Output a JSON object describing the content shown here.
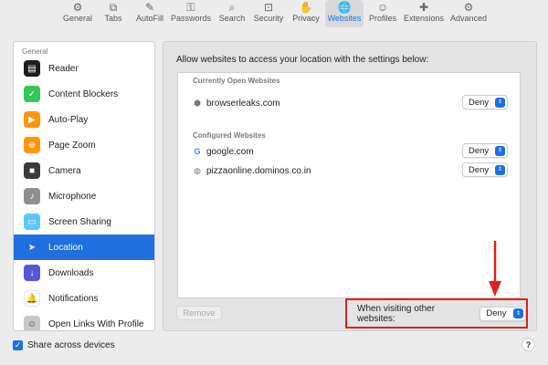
{
  "toolbar": {
    "items": [
      {
        "label": "General",
        "icon": "gear-icon",
        "glyph": "⚙"
      },
      {
        "label": "Tabs",
        "icon": "tabs-icon",
        "glyph": "⧉"
      },
      {
        "label": "AutoFill",
        "icon": "autofill-icon",
        "glyph": "✎"
      },
      {
        "label": "Passwords",
        "icon": "key-icon",
        "glyph": "⚿"
      },
      {
        "label": "Search",
        "icon": "search-icon",
        "glyph": "⌕"
      },
      {
        "label": "Security",
        "icon": "lock-icon",
        "glyph": "⊡"
      },
      {
        "label": "Privacy",
        "icon": "hand-icon",
        "glyph": "✋"
      },
      {
        "label": "Websites",
        "icon": "globe-icon",
        "glyph": "🌐"
      },
      {
        "label": "Profiles",
        "icon": "person-icon",
        "glyph": "☺"
      },
      {
        "label": "Extensions",
        "icon": "puzzle-icon",
        "glyph": "✚"
      },
      {
        "label": "Advanced",
        "icon": "gears-icon",
        "glyph": "⚙"
      }
    ],
    "active": "Websites"
  },
  "sidebar": {
    "header": "General",
    "items": [
      {
        "label": "Reader",
        "icon": "reader-icon",
        "glyph": "▤",
        "color": "#1d1d1f"
      },
      {
        "label": "Content Blockers",
        "icon": "content-blockers-icon",
        "glyph": "✓",
        "color": "#34c759"
      },
      {
        "label": "Auto-Play",
        "icon": "autoplay-icon",
        "glyph": "▶",
        "color": "#ff9500"
      },
      {
        "label": "Page Zoom",
        "icon": "page-zoom-icon",
        "glyph": "⊕",
        "color": "#ff9500"
      },
      {
        "label": "Camera",
        "icon": "camera-icon",
        "glyph": "■",
        "color": "#3a3a3c"
      },
      {
        "label": "Microphone",
        "icon": "microphone-icon",
        "glyph": "♪",
        "color": "#8e8e93"
      },
      {
        "label": "Screen Sharing",
        "icon": "screen-sharing-icon",
        "glyph": "▭",
        "color": "#5ac8fa"
      },
      {
        "label": "Location",
        "icon": "location-icon",
        "glyph": "➤",
        "color": "#1f6fe0"
      },
      {
        "label": "Downloads",
        "icon": "downloads-icon",
        "glyph": "↓",
        "color": "#5856d6"
      },
      {
        "label": "Notifications",
        "icon": "notifications-icon",
        "glyph": "🔔",
        "color": "#ffffff"
      },
      {
        "label": "Open Links With Profile",
        "icon": "profile-icon",
        "glyph": "☺",
        "color": "#c7c7cc"
      }
    ],
    "selected": "Location"
  },
  "main": {
    "description": "Allow websites to access your location with the settings below:",
    "open_header": "Currently Open Websites",
    "open_sites": [
      {
        "name": "browserleaks.com",
        "setting": "Deny",
        "icon": "site-favicon-icon",
        "glyph": "⬢"
      }
    ],
    "configured_header": "Configured Websites",
    "configured_sites": [
      {
        "name": "google.com",
        "setting": "Deny",
        "icon": "google-favicon-icon",
        "glyph": "G"
      },
      {
        "name": "pizzaonline.dominos.co.in",
        "setting": "Deny",
        "icon": "globe-favicon-icon",
        "glyph": "◍"
      }
    ],
    "remove_label": "Remove",
    "other_label": "When visiting other websites:",
    "other_value": "Deny"
  },
  "footer": {
    "share_label": "Share across devices",
    "share_checked": true,
    "help_label": "?"
  },
  "colors": {
    "accent": "#1f6fe0",
    "highlight_box": "#e02020"
  }
}
